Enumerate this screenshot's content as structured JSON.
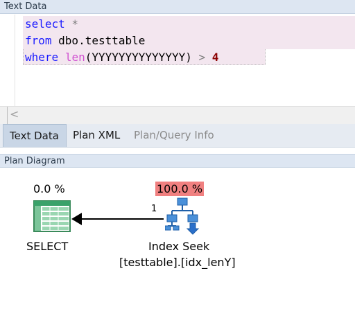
{
  "text_panel": {
    "header": "Text Data",
    "code": {
      "line1_kw": "select",
      "line1_rest": " *",
      "line2_kw": "from",
      "line2_rest": " dbo.testtable",
      "line3_kw": "where",
      "line3_fn": "len",
      "line3_arg": "(YYYYYYYYYYYYYY)",
      "line3_op": " >",
      "line3_num": "4"
    },
    "scroll_left": "<"
  },
  "tabs": [
    {
      "label": "Text Data",
      "state": "active"
    },
    {
      "label": "Plan XML",
      "state": "normal"
    },
    {
      "label": "Plan/Query Info",
      "state": "disabled"
    }
  ],
  "plan_panel": {
    "header": "Plan Diagram",
    "select_node": {
      "percent": "0.0 %",
      "label": "SELECT",
      "icon": "result-grid-icon"
    },
    "seek_node": {
      "percent": "100.0 %",
      "label": "Index Seek",
      "object": "[testtable].[idx_lenY]",
      "icon": "index-seek-icon"
    },
    "edge": {
      "label": "1"
    },
    "colors": {
      "hot_percent_bg": "#f08080"
    }
  }
}
